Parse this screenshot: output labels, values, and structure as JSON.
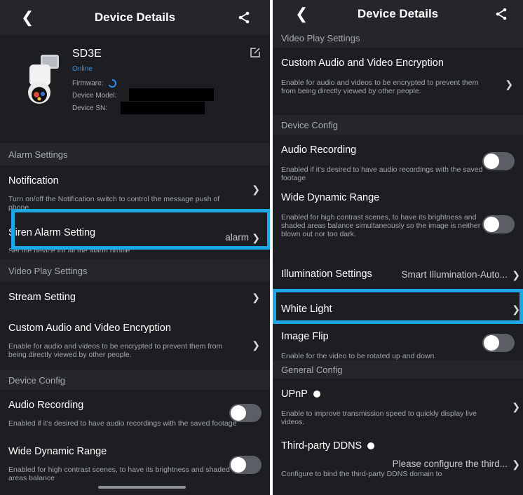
{
  "left": {
    "title": "Device Details",
    "device": {
      "name": "SD3E",
      "status": "Online",
      "firmware_label": "Firmware:",
      "model_label": "Device Model:",
      "sn_label": "Device SN:"
    },
    "alarm_section": "Alarm Settings",
    "notification": {
      "title": "Notification",
      "desc": "Turn on/off the Notification switch to control the message push of phone."
    },
    "siren": {
      "title": "Siren Alarm Setting",
      "value": "alarm",
      "desc": "Set the device for all the alarm profile"
    },
    "video_section": "Video Play Settings",
    "stream": {
      "title": "Stream Setting"
    },
    "encryption": {
      "title": "Custom Audio and Video Encryption",
      "desc": "Enable for audio and videos to be encrypted to prevent them from being directly viewed by other people."
    },
    "device_section": "Device Config",
    "audio": {
      "title": "Audio Recording",
      "desc": "Enabled if it's desired to have audio recordings with the saved footage"
    },
    "wdr": {
      "title": "Wide Dynamic Range",
      "desc": "Enabled for high contrast scenes, to have its brightness and shaded areas balance"
    }
  },
  "right": {
    "title": "Device Details",
    "video_section": "Video Play Settings",
    "encryption": {
      "title": "Custom Audio and Video Encryption",
      "desc": "Enable for audio and videos to be encrypted to prevent them from being directly viewed by other people."
    },
    "device_section": "Device Config",
    "audio": {
      "title": "Audio Recording",
      "desc": "Enabled if it's desired to have audio recordings with the saved footage"
    },
    "wdr": {
      "title": "Wide Dynamic Range",
      "desc": "Enabled for high contrast scenes, to have its brightness and shaded areas balance simultaneously so the image is neither blown out nor too dark."
    },
    "illumination": {
      "title": "Illumination Settings",
      "value": "Smart Illumination-Auto..."
    },
    "white_light": {
      "title": "White Light"
    },
    "flip": {
      "title": "Image Flip",
      "desc": "Enable for the video to be rotated up and down."
    },
    "general_section": "General Config",
    "upnp": {
      "title": "UPnP",
      "desc": "Enable to improve transmission speed to quickly display live videos."
    },
    "ddns": {
      "title": "Third-party DDNS",
      "value": "Please configure the third...",
      "desc": "Configure to bind the third-party DDNS domain to"
    }
  },
  "colors": {
    "accent_blue": "#1ea7e8",
    "online_blue": "#2f8df7",
    "background": "#1c1e22",
    "section_bg": "#24262b"
  },
  "toggles": {
    "left_audio": false,
    "left_wdr": false,
    "right_audio": false,
    "right_wdr": false,
    "right_flip": false
  }
}
